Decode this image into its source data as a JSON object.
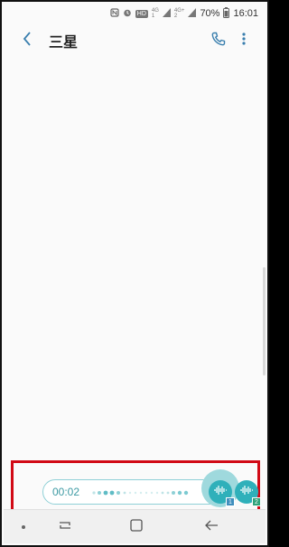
{
  "status_bar": {
    "icons": [
      "nfc-icon",
      "alarm-icon",
      "hd-icon",
      "signal-4g-1-icon",
      "signal-4g-2-icon"
    ],
    "hd_label": "HD",
    "net1_label": "4G",
    "net1_sub": "1",
    "net2_label": "4G+",
    "net2_sub": "2",
    "battery": "70%",
    "time": "16:01"
  },
  "header": {
    "title": "三星"
  },
  "recorder": {
    "elapsed": "00:02",
    "accent": "#2fb0ba"
  },
  "voice_messages": [
    {
      "badge": "1"
    },
    {
      "badge": "2"
    }
  ],
  "colors": {
    "accent": "#3d9aa3",
    "highlight": "#d10a16"
  }
}
